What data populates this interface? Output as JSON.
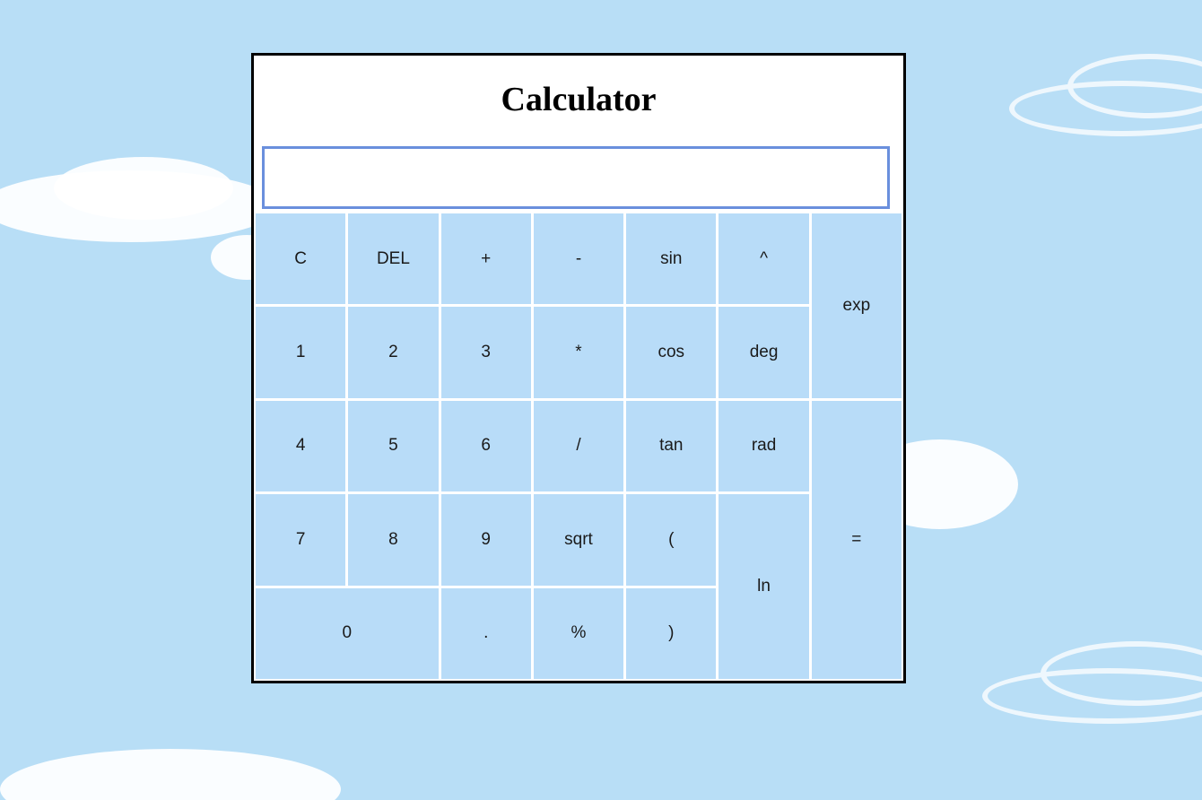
{
  "calculator": {
    "title": "Calculator",
    "display": {
      "value": "",
      "placeholder": ""
    },
    "keys": {
      "clear": "C",
      "delete": "DEL",
      "plus": "+",
      "minus": "-",
      "sin": "sin",
      "power": "^",
      "exp": "exp",
      "one": "1",
      "two": "2",
      "three": "3",
      "multiply": "*",
      "cos": "cos",
      "deg": "deg",
      "four": "4",
      "five": "5",
      "six": "6",
      "divide": "/",
      "tan": "tan",
      "rad": "rad",
      "equals": "=",
      "seven": "7",
      "eight": "8",
      "nine": "9",
      "sqrt": "sqrt",
      "open_paren": "(",
      "ln": "ln",
      "zero": "0",
      "decimal": ".",
      "percent": "%",
      "close_paren": ")"
    }
  },
  "colors": {
    "background": "#b8def6",
    "key": "#b8dcf8",
    "display_border": "#6a8fdd",
    "panel_border": "#000000"
  }
}
